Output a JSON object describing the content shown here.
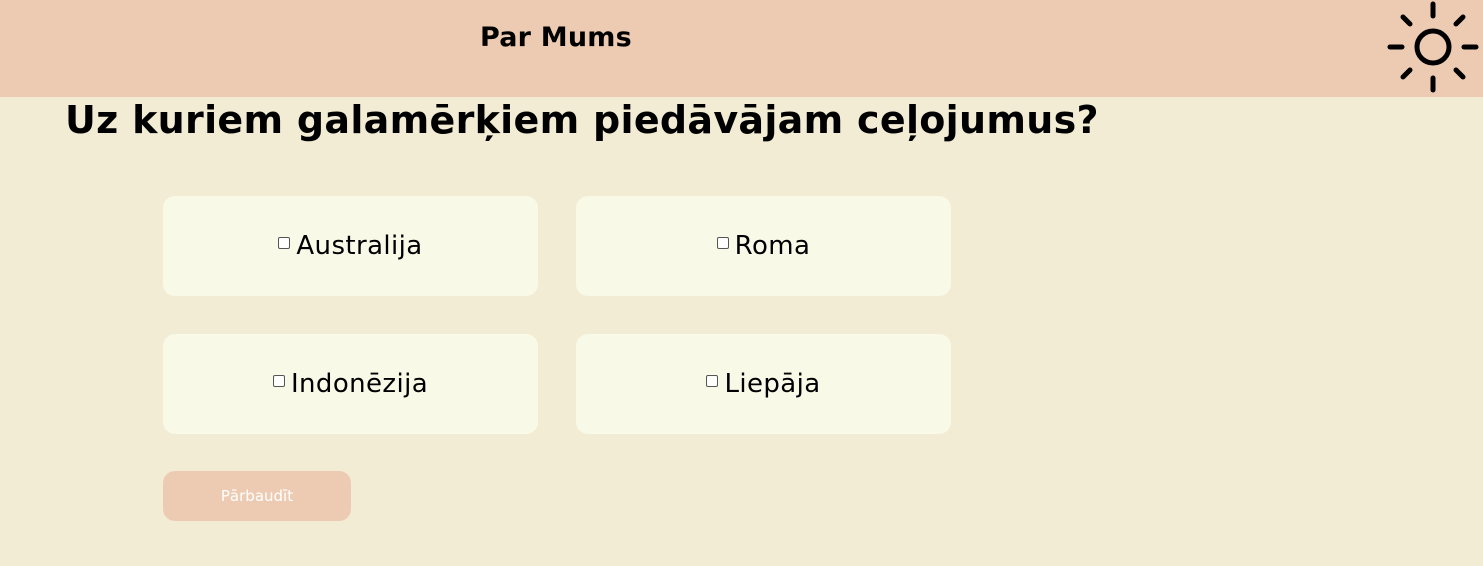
{
  "header": {
    "nav_link": "Par Mums",
    "theme_icon": "sun-icon",
    "background_color": "#edcbb2"
  },
  "quiz": {
    "question": "Uz kuriem galamērķiem piedāvājam ceļojumus?",
    "options": [
      {
        "label": "Australija",
        "checked": false
      },
      {
        "label": "Roma",
        "checked": false
      },
      {
        "label": "Indonēzija",
        "checked": false
      },
      {
        "label": "Liepāja",
        "checked": false
      }
    ],
    "submit_label": "Pārbaudīt"
  },
  "colors": {
    "page_background": "#f2ecd5",
    "card_background": "#f8f9e6",
    "accent": "#edcbb2"
  }
}
